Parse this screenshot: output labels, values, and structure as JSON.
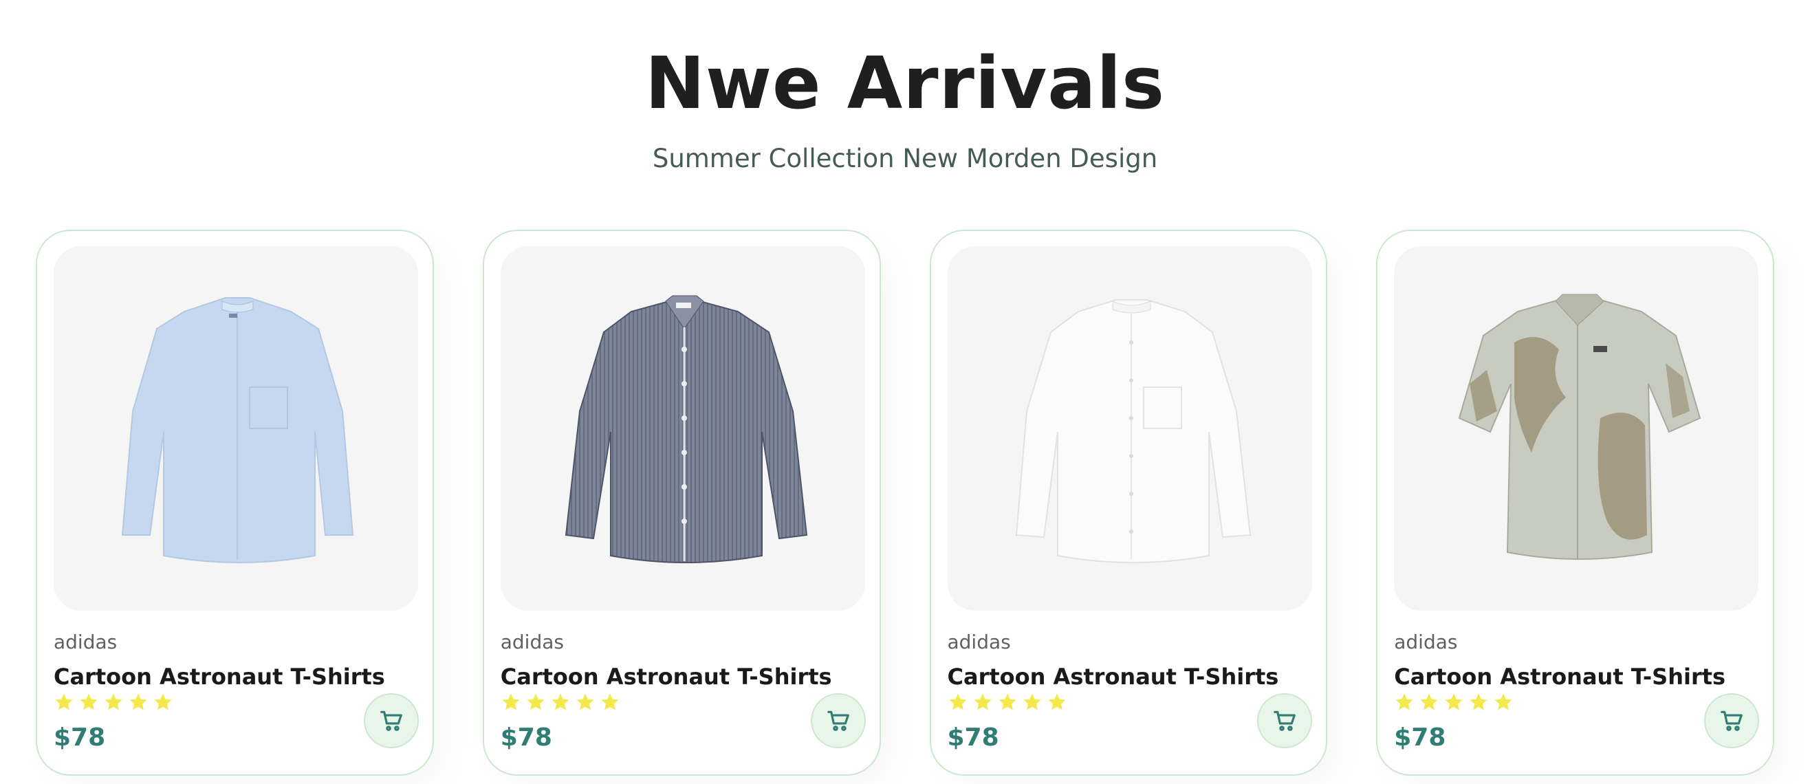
{
  "header": {
    "title": "Nwe Arrivals",
    "subtitle": "Summer Collection New Morden Design"
  },
  "colors": {
    "accent": "#088178",
    "star": "#f3e94a",
    "card_border": "#cce7d0",
    "cart_bg": "#e8f6ea"
  },
  "products": [
    {
      "brand": "adidas",
      "name": "Cartoon Astronaut T-Shirts",
      "rating": 5,
      "price": "$78",
      "icon": "cart-icon"
    },
    {
      "brand": "adidas",
      "name": "Cartoon Astronaut T-Shirts",
      "rating": 5,
      "price": "$78",
      "icon": "cart-icon"
    },
    {
      "brand": "adidas",
      "name": "Cartoon Astronaut T-Shirts",
      "rating": 5,
      "price": "$78",
      "icon": "cart-icon"
    },
    {
      "brand": "adidas",
      "name": "Cartoon Astronaut T-Shirts",
      "rating": 5,
      "price": "$78",
      "icon": "cart-icon"
    }
  ]
}
